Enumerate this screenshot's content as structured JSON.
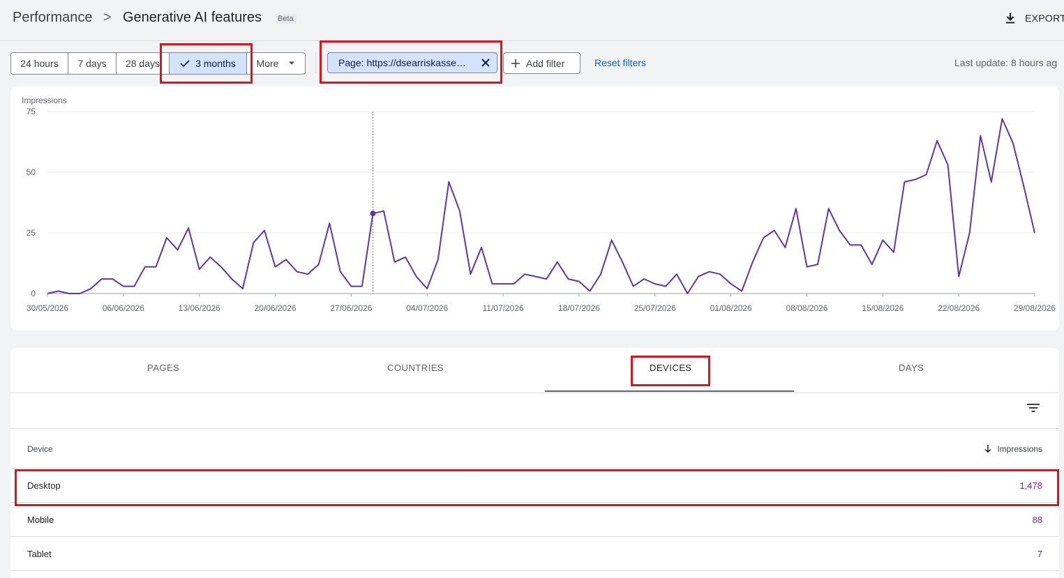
{
  "header": {
    "breadcrumb_root": "Performance",
    "breadcrumb_sep": ">",
    "title": "Generative AI features",
    "badge": "Beta",
    "export_label": "EXPORT"
  },
  "date_filters": [
    {
      "label": "24 hours",
      "selected": false
    },
    {
      "label": "7 days",
      "selected": false
    },
    {
      "label": "28 days",
      "selected": false
    },
    {
      "label": "3 months",
      "selected": true
    },
    {
      "label": "More",
      "selected": false
    }
  ],
  "filter_chip": {
    "label": "Page: https://dsearriskasse…"
  },
  "add_filter_label": "Add filter",
  "reset_filters_label": "Reset filters",
  "last_update": "Last update: 8 hours ag",
  "chart_data": {
    "type": "line",
    "ylabel": "Impressions",
    "ylim": [
      0,
      75
    ],
    "yticks": [
      0,
      25,
      50,
      75
    ],
    "xticks": [
      "30/05/2026",
      "06/06/2026",
      "13/06/2026",
      "20/06/2026",
      "27/06/2026",
      "04/07/2026",
      "11/07/2026",
      "18/07/2026",
      "25/07/2026",
      "01/08/2026",
      "08/08/2026",
      "15/08/2026",
      "22/08/2026",
      "29/08/2026"
    ],
    "x_start": "30/05/2026",
    "x_end": "29/08/2026",
    "grid": true,
    "highlighted_point": {
      "x": "28/06/2026",
      "y": 33
    },
    "series": [
      {
        "color": "#5e35b1",
        "values": [
          0,
          1,
          0,
          0,
          2,
          6,
          6,
          3,
          3,
          11,
          11,
          23,
          18,
          27,
          10,
          15,
          11,
          6,
          2,
          21,
          26,
          11,
          14,
          9,
          8,
          12,
          29,
          9,
          3,
          3,
          33,
          34,
          13,
          15,
          7,
          2,
          14,
          46,
          34,
          8,
          19,
          4,
          4,
          4,
          8,
          7,
          6,
          13,
          6,
          5,
          1,
          8,
          22,
          13,
          3,
          6,
          4,
          3,
          8,
          0,
          7,
          9,
          8,
          4,
          1,
          13,
          23,
          26,
          19,
          35,
          11,
          12,
          35,
          26,
          20,
          20,
          12,
          22,
          17,
          46,
          47,
          49,
          63,
          53,
          7,
          25,
          65,
          46,
          72,
          62,
          44,
          25
        ]
      }
    ]
  },
  "tabs": [
    {
      "label": "PAGES",
      "active": false
    },
    {
      "label": "COUNTRIES",
      "active": false
    },
    {
      "label": "DEVICES",
      "active": true
    },
    {
      "label": "DAYS",
      "active": false
    }
  ],
  "table": {
    "col_device": "Device",
    "col_impressions": "Impressions",
    "rows": [
      {
        "device": "Desktop",
        "impressions": "1,478"
      },
      {
        "device": "Mobile",
        "impressions": "88"
      },
      {
        "device": "Tablet",
        "impressions": "7"
      }
    ]
  },
  "colors": {
    "accent": "#5e35b1",
    "selected_bg": "#d3e3fd",
    "link": "#1a5fc7",
    "annotation": "#e0131b",
    "value": "#7b1fa2"
  }
}
